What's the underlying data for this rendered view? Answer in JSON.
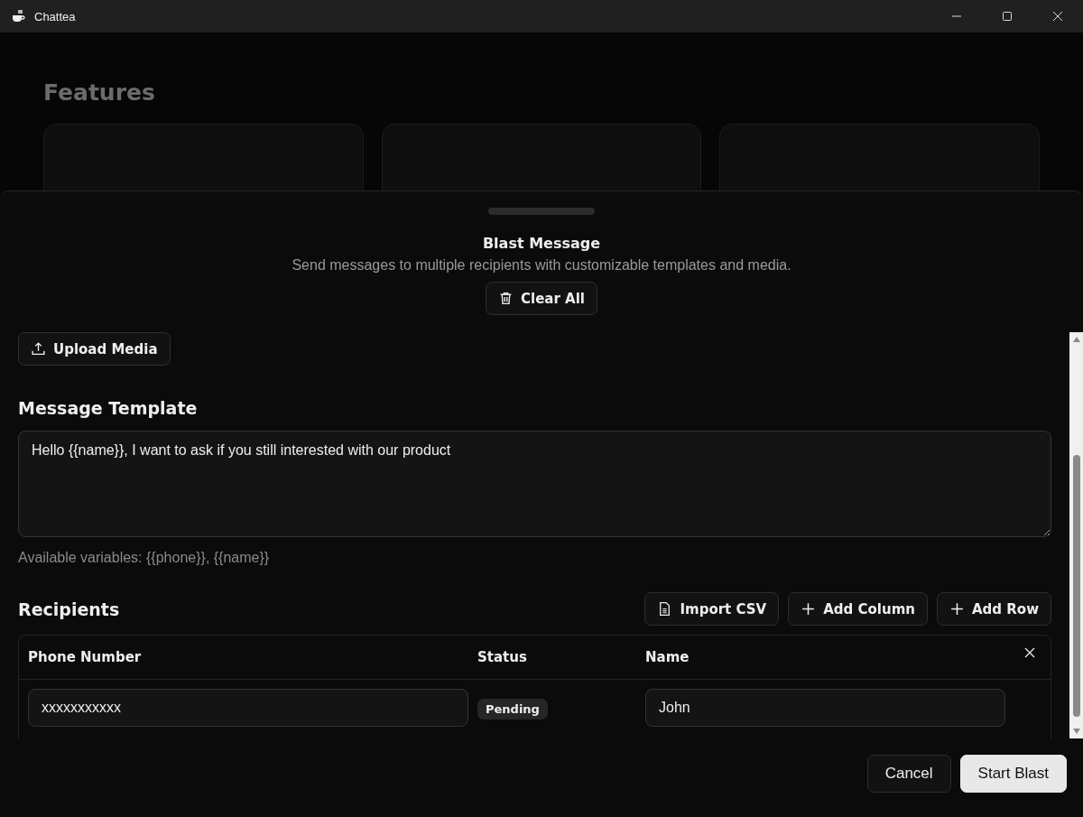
{
  "window": {
    "title": "Chattea"
  },
  "background": {
    "heading": "Features"
  },
  "sheet": {
    "title": "Blast Message",
    "description": "Send messages to multiple recipients with customizable templates and media.",
    "clear_button": "Clear All",
    "upload_button": "Upload Media",
    "template": {
      "heading": "Message Template",
      "value": "Hello {{name}}, I want to ask if you still interested with our product",
      "hint": "Available variables: {{phone}}, {{name}}"
    },
    "recipients": {
      "heading": "Recipients",
      "actions": [
        {
          "label": "Import CSV",
          "kind": "import"
        },
        {
          "label": "Add Column",
          "kind": "add"
        },
        {
          "label": "Add Row",
          "kind": "add"
        }
      ],
      "columns": [
        "Phone Number",
        "Status",
        "Name"
      ],
      "rows": [
        {
          "phone": "xxxxxxxxxxx",
          "status": "Pending",
          "name": "John"
        }
      ]
    },
    "footer": [
      {
        "label": "Cancel",
        "kind": "secondary"
      },
      {
        "label": "Start Blast",
        "kind": "primary"
      }
    ]
  }
}
